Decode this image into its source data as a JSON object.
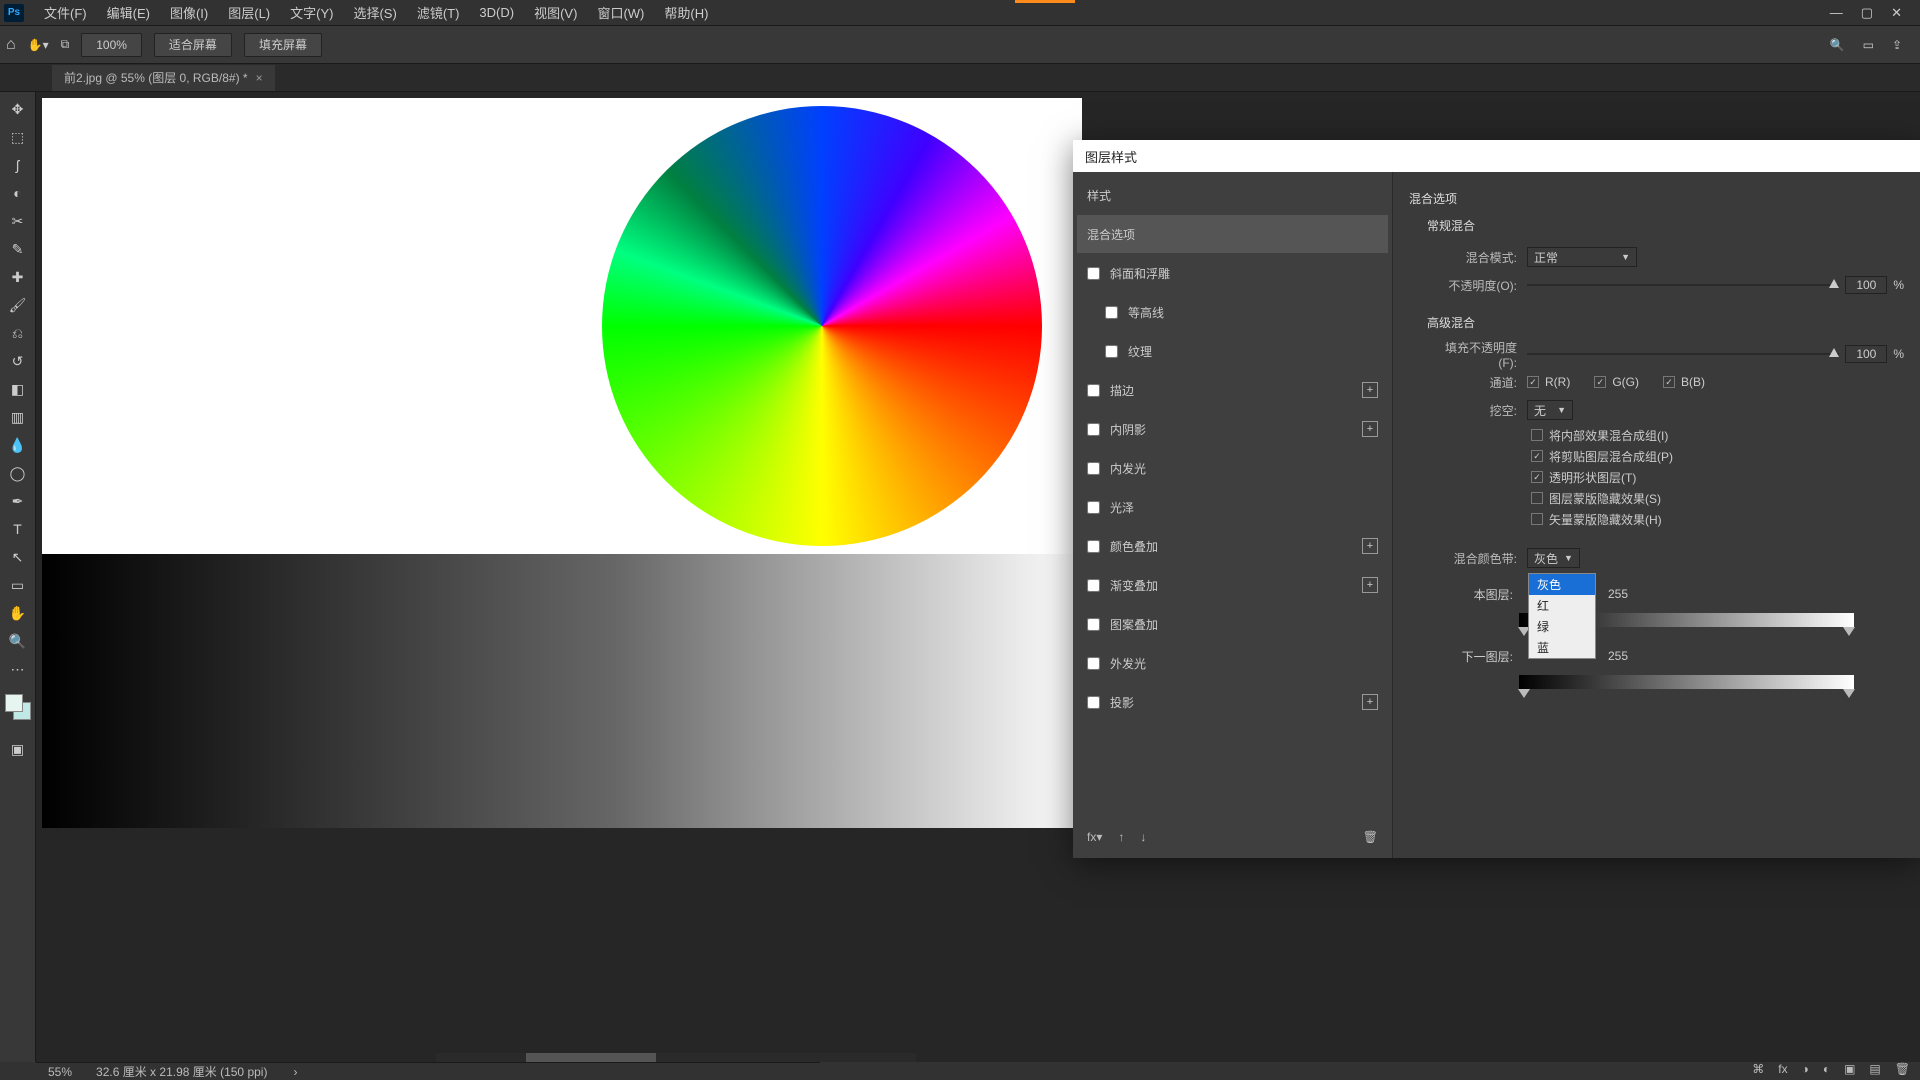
{
  "menu": {
    "items": [
      "文件(F)",
      "编辑(E)",
      "图像(I)",
      "图层(L)",
      "文字(Y)",
      "选择(S)",
      "滤镜(T)",
      "3D(D)",
      "视图(V)",
      "窗口(W)",
      "帮助(H)"
    ]
  },
  "optbar": {
    "zoom": "100%",
    "fit": "适合屏幕",
    "fill": "填充屏幕"
  },
  "tab": {
    "title": "前2.jpg @ 55% (图层 0, RGB/8#) *"
  },
  "statusbar": {
    "zoom": "55%",
    "doc": "32.6 厘米 x 21.98 厘米 (150 ppi)"
  },
  "dialog": {
    "title": "图层样式",
    "styles_header": "样式",
    "blend_options": "混合选项",
    "styles": [
      {
        "label": "斜面和浮雕",
        "plus": false
      },
      {
        "label": "等高线",
        "plus": false,
        "indent": true
      },
      {
        "label": "纹理",
        "plus": false,
        "indent": true
      },
      {
        "label": "描边",
        "plus": true
      },
      {
        "label": "内阴影",
        "plus": true
      },
      {
        "label": "内发光",
        "plus": false
      },
      {
        "label": "光泽",
        "plus": false
      },
      {
        "label": "颜色叠加",
        "plus": true
      },
      {
        "label": "渐变叠加",
        "plus": true
      },
      {
        "label": "图案叠加",
        "plus": false
      },
      {
        "label": "外发光",
        "plus": false
      },
      {
        "label": "投影",
        "plus": true
      }
    ],
    "right": {
      "section_blend": "混合选项",
      "section_general": "常规混合",
      "mode_label": "混合模式:",
      "mode_value": "正常",
      "opacity_label": "不透明度(O):",
      "opacity_value": "100",
      "pct": "%",
      "section_adv": "高级混合",
      "fill_label": "填充不透明度(F):",
      "fill_value": "100",
      "channels_label": "通道:",
      "ch_r": "R(R)",
      "ch_g": "G(G)",
      "ch_b": "B(B)",
      "knockout_label": "挖空:",
      "knockout_value": "无",
      "ck1": "将内部效果混合成组(I)",
      "ck2": "将剪贴图层混合成组(P)",
      "ck3": "透明形状图层(T)",
      "ck4": "图层蒙版隐藏效果(S)",
      "ck5": "矢量蒙版隐藏效果(H)",
      "blendif_label": "混合颜色带:",
      "blendif_value": "灰色",
      "this_label": "本图层:",
      "this_max": "255",
      "under_label": "下一图层:",
      "under_max": "255",
      "dropdown": [
        "灰色",
        "红",
        "绿",
        "蓝"
      ]
    }
  }
}
